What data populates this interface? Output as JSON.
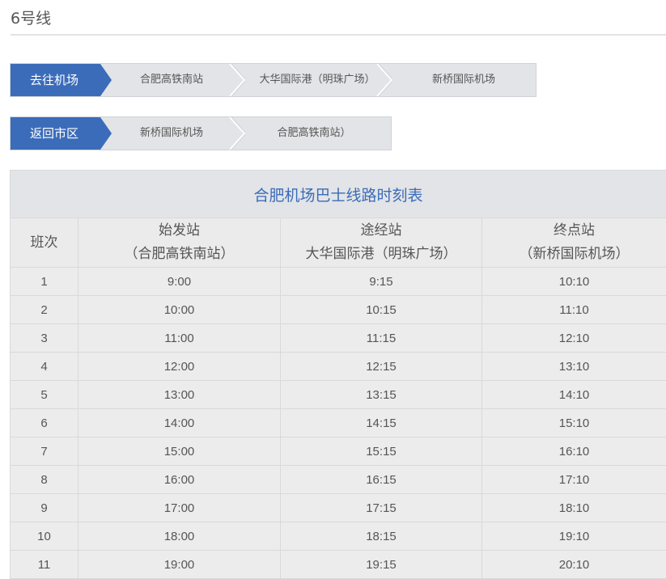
{
  "page": {
    "title": "6号线"
  },
  "routes": {
    "outbound": {
      "label": "去往机场",
      "stops": [
        "合肥高铁南站",
        "大华国际港（明珠广场）",
        "新桥国际机场"
      ]
    },
    "inbound": {
      "label": "返回市区",
      "stops": [
        "新桥国际机场",
        "合肥高铁南站）"
      ]
    }
  },
  "timetable": {
    "caption": "合肥机场巴士线路时刻表",
    "headers": {
      "run": "班次",
      "origin": "始发站",
      "origin_sub": "（合肥高铁南站）",
      "via": "途经站",
      "via_sub": "大华国际港（明珠广场）",
      "terminal": "终点站",
      "terminal_sub": "（新桥国际机场）"
    },
    "rows": [
      [
        "1",
        "9:00",
        "9:15",
        "10:10"
      ],
      [
        "2",
        "10:00",
        "10:15",
        "11:10"
      ],
      [
        "3",
        "11:00",
        "11:15",
        "12:10"
      ],
      [
        "4",
        "12:00",
        "12:15",
        "13:10"
      ],
      [
        "5",
        "13:00",
        "13:15",
        "14:10"
      ],
      [
        "6",
        "14:00",
        "14:15",
        "15:10"
      ],
      [
        "7",
        "15:00",
        "15:15",
        "16:10"
      ],
      [
        "8",
        "16:00",
        "16:15",
        "17:10"
      ],
      [
        "9",
        "17:00",
        "17:15",
        "18:10"
      ],
      [
        "10",
        "18:00",
        "18:15",
        "19:10"
      ],
      [
        "11",
        "19:00",
        "19:15",
        "20:10"
      ]
    ]
  },
  "colors": {
    "accent": "#3b6cb9",
    "bar_bg": "#e2e4e7",
    "cell_bg": "#ececec"
  }
}
